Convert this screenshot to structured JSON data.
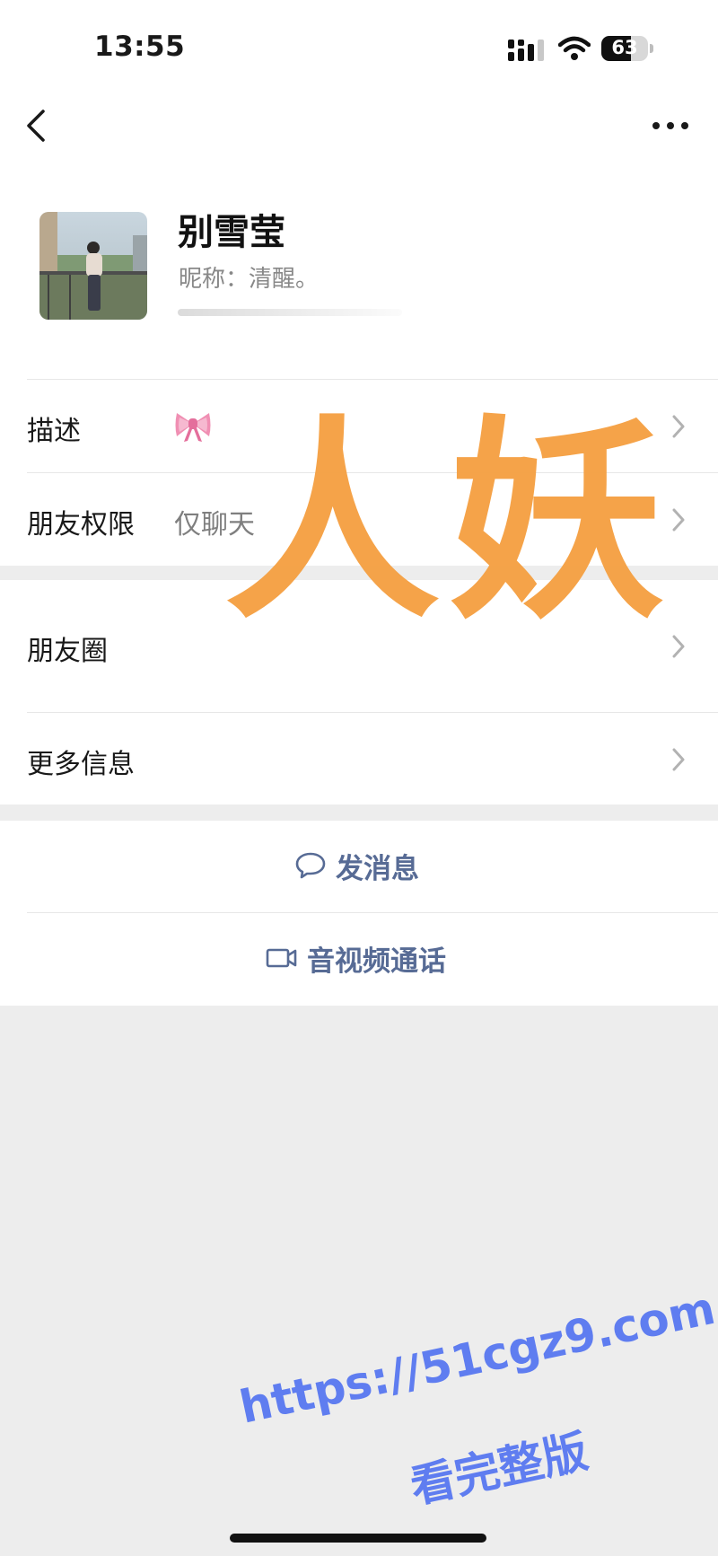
{
  "status_bar": {
    "time": "13:55",
    "battery": "63",
    "battery_level": 0.63
  },
  "profile": {
    "name": "别雪莹",
    "nickname_label": "昵称：",
    "nickname": "清醒。"
  },
  "rows": {
    "description": {
      "label": "描述",
      "value_icon": "ribbon-bow-icon"
    },
    "friend_permission": {
      "label": "朋友权限",
      "value": "仅聊天"
    },
    "moments": {
      "label": "朋友圈"
    },
    "more_info": {
      "label": "更多信息"
    }
  },
  "actions": {
    "send_message": {
      "label": "发消息",
      "icon": "chat-bubble-icon"
    },
    "av_call": {
      "label": "音视频通话",
      "icon": "video-camera-icon"
    }
  },
  "watermarks": {
    "overlay": "人妖",
    "url": "https://51cgz9.com",
    "sub": "看完整版"
  },
  "colors": {
    "accent": "#576b95",
    "overlay": "#f5a144",
    "url_watermark": "#5f7df0",
    "background": "#ededed"
  }
}
